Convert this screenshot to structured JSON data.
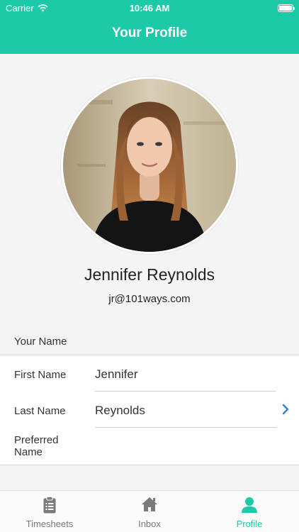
{
  "status_bar": {
    "carrier": "Carrier",
    "time": "10:46 AM"
  },
  "nav": {
    "title": "Your Profile"
  },
  "profile": {
    "name": "Jennifer Reynolds",
    "email": "jr@101ways.com"
  },
  "section": {
    "header": "Your Name",
    "fields": {
      "first_name": {
        "label": "First Name",
        "value": "Jennifer"
      },
      "last_name": {
        "label": "Last Name",
        "value": "Reynolds"
      },
      "preferred_name": {
        "label_line1": "Preferred",
        "label_line2": "Name",
        "value": ""
      }
    }
  },
  "tabs": {
    "timesheets": {
      "label": "Timesheets",
      "icon": "clipboard-icon"
    },
    "inbox": {
      "label": "Inbox",
      "icon": "home-icon"
    },
    "profile": {
      "label": "Profile",
      "icon": "person-icon"
    }
  },
  "colors": {
    "accent": "#1ccaa9",
    "chevron": "#2f7fd0",
    "tab_inactive": "#7a7a7a"
  }
}
